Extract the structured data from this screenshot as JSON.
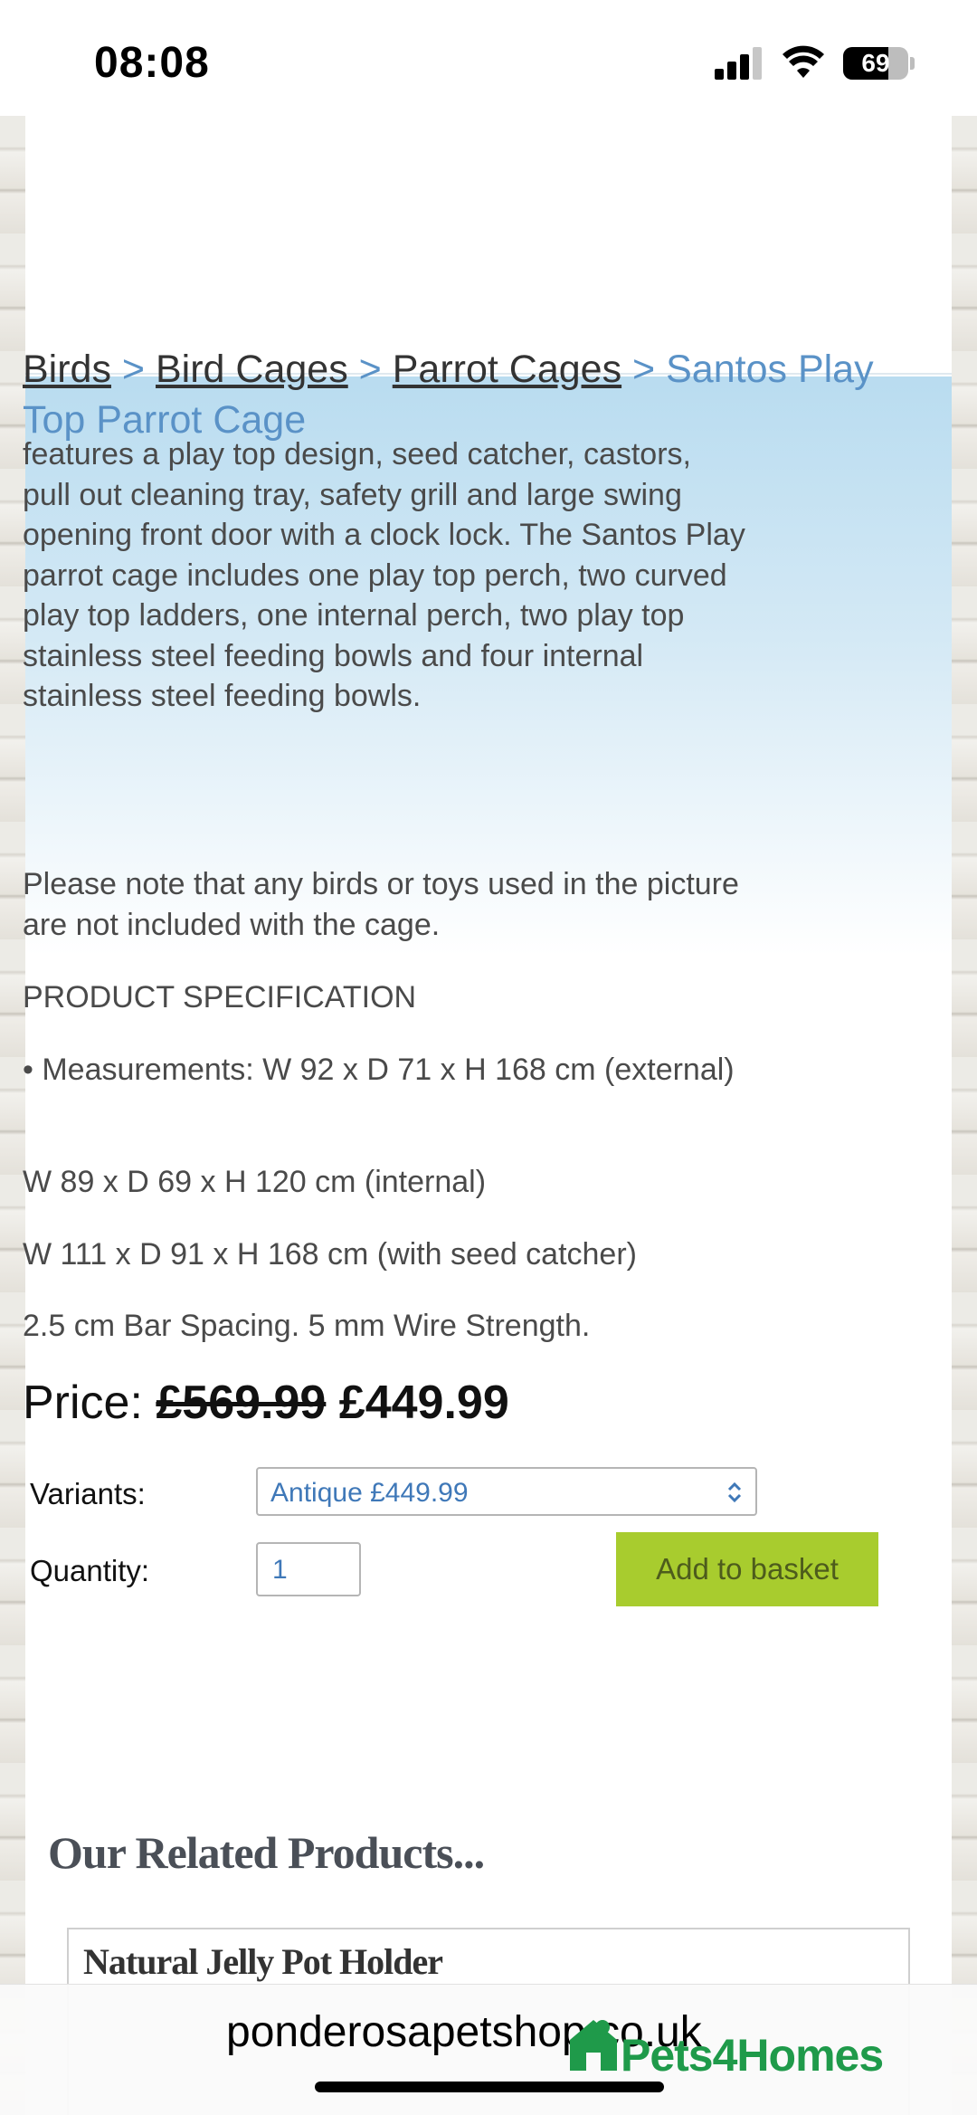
{
  "status_bar": {
    "time": "08:08",
    "battery": "69",
    "battery_level": 0.69
  },
  "breadcrumb": {
    "items": [
      "Birds",
      "Bird Cages",
      "Parrot Cages"
    ],
    "separator": ">",
    "current": "Santos Play Top Parrot Cage"
  },
  "product": {
    "description": "features a play top design, seed catcher, castors, pull out cleaning tray, safety grill and large swing opening front door with a clock lock. The Santos Play parrot cage includes one play top perch, two curved play top ladders, one internal perch, two play top stainless steel feeding bowls and four internal stainless steel feeding bowls.",
    "note": "Please note that any birds or toys used in the picture are not included with the cage.",
    "spec_heading": "PRODUCT SPECIFICATION",
    "spec_measurements": "• Measurements: W 92 x D 71 x H 168 cm (external)",
    "spec_internal": "W 89 x D 69 x H 120 cm (internal)",
    "spec_seed_catcher": "W 111 x D 91 x H 168 cm (with seed catcher)",
    "spec_bars": "2.5 cm Bar Spacing. 5 mm Wire Strength.",
    "price_label": "Price:",
    "old_price": "£569.99",
    "new_price": "£449.99"
  },
  "form": {
    "variants_label": "Variants:",
    "variant_selected": "Antique £449.99",
    "quantity_label": "Quantity:",
    "quantity_value": "1",
    "add_button": "Add to basket"
  },
  "related": {
    "title": "Our Related Products...",
    "items": [
      {
        "name": "Natural Jelly Pot Holder"
      }
    ]
  },
  "browser": {
    "domain": "ponderosapetshop.co.uk",
    "overlay_brand": "Pets4Homes"
  },
  "colors": {
    "link": "#5a92c7",
    "button": "#a8cc2e",
    "brand_green": "#1f9a4a"
  }
}
